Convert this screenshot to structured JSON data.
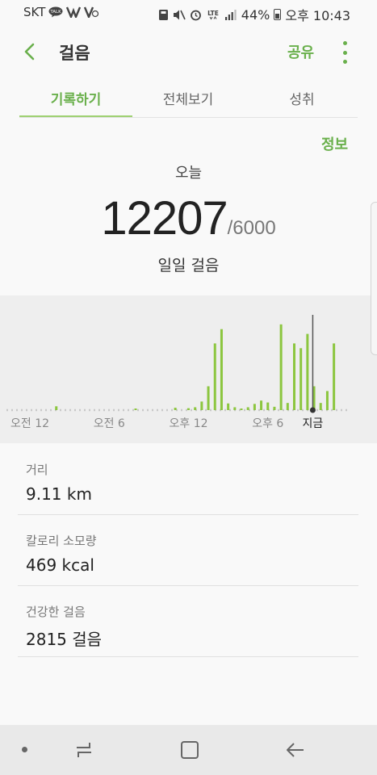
{
  "status_bar": {
    "carrier": "SKT",
    "talk_badge": "TALK",
    "lte": "LTE",
    "battery": "44%",
    "time": "오후 10:43"
  },
  "app_bar": {
    "title": "걸음",
    "share": "공유"
  },
  "tabs": [
    {
      "label": "기록하기",
      "active": true
    },
    {
      "label": "전체보기",
      "active": false
    },
    {
      "label": "성취",
      "active": false
    }
  ],
  "summary": {
    "info_link": "정보",
    "today": "오늘",
    "steps": "12207",
    "goal": "/6000",
    "label": "일일 걸음"
  },
  "chart_data": {
    "type": "bar",
    "xlabel": "",
    "ylabel": "",
    "tick_labels": [
      "오전 12",
      "오전 6",
      "오후 12",
      "오후 6",
      "지금"
    ],
    "x_hours": [
      2,
      8,
      11,
      12,
      12.5,
      13,
      13.5,
      14,
      14.5,
      15,
      15.5,
      16,
      16.5,
      17,
      17.5,
      18,
      18.5,
      19,
      19.5,
      20,
      20.5,
      21,
      21.5,
      22,
      22.5,
      23
    ],
    "values": [
      80,
      20,
      50,
      40,
      60,
      180,
      500,
      1400,
      1700,
      140,
      60,
      20,
      60,
      130,
      200,
      160,
      70,
      1800,
      150,
      1400,
      1300,
      1600,
      500,
      150,
      400,
      1400
    ],
    "now_hour": 21.4,
    "x_range": [
      0,
      24
    ],
    "ylim": [
      0,
      2000
    ],
    "bar_color": "#8cc63f",
    "baseline_color": "#c8c8c8"
  },
  "stats": [
    {
      "label": "거리",
      "value": "9.11 km"
    },
    {
      "label": "칼로리 소모량",
      "value": "469 kcal"
    },
    {
      "label": "건강한 걸음",
      "value": "2815 걸음"
    }
  ],
  "colors": {
    "accent": "#6ab04c",
    "tab_underline": "#9ed071"
  }
}
